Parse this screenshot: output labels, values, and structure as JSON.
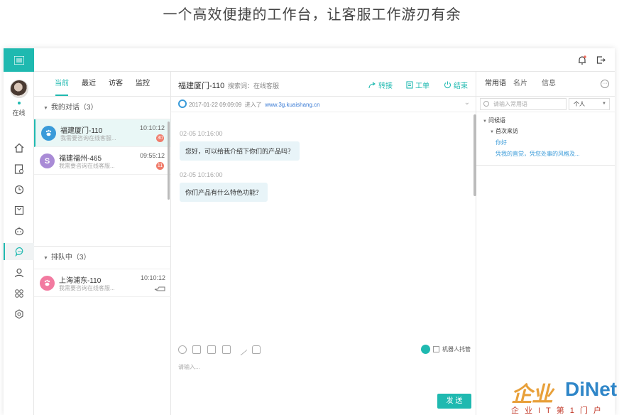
{
  "headline": "一个高效便捷的工作台，让客服工作游刃有余",
  "rail": {
    "status": "在线",
    "icons": [
      "home-icon",
      "report-icon",
      "history-icon",
      "order-icon",
      "robot-icon",
      "chat-icon",
      "contacts-icon",
      "apps-icon",
      "settings-icon"
    ]
  },
  "conversations": {
    "tabs": [
      "当前",
      "最近",
      "访客",
      "监控"
    ],
    "active_tab": "当前",
    "my_group": "我的对话（3）",
    "my_items": [
      {
        "name": "福建厦门-110",
        "preview": "我需要咨询在线客服...",
        "time": "10:10:12",
        "badge": "30",
        "avatar": "paw",
        "color": "#3a9bd9"
      },
      {
        "name": "福建福州-465",
        "preview": "我需要咨询在线客服...",
        "time": "09:55:12",
        "badge": "11",
        "avatar": "S",
        "color": "#a98bd6"
      }
    ],
    "queue_group": "排队中（3）",
    "queue_items": [
      {
        "name": "上海浦东-110",
        "preview": "我需要咨询在线客服...",
        "time": "10:10:12",
        "avatar": "paw",
        "color": "#f27aa0"
      }
    ]
  },
  "chat": {
    "title": "福建厦门-110",
    "keyword": "搜索词：在线客服",
    "actions": {
      "transfer": "转接",
      "ticket": "工单",
      "end": "结束"
    },
    "visit_time": "2017-01-22 09:09:09",
    "visit_enter": "进入了",
    "visit_site": "www.3g.kuaishang.cn",
    "messages": [
      {
        "time": "02-05 10:16:00",
        "text": "您好，可以给我介绍下你们的产品吗？"
      },
      {
        "time": "02-05 10:16:00",
        "text": "你们产品有什么特色功能？"
      }
    ],
    "robot_label": "机器人托管",
    "input_placeholder": "请输入...",
    "send": "发 送"
  },
  "right": {
    "tabs": [
      "常用语",
      "名片",
      "信息"
    ],
    "active_tab": "常用语",
    "search_placeholder": "请输入常用语",
    "scope": "个人",
    "tree": {
      "root": "问候语",
      "child": "首次来访",
      "items": [
        "你好",
        "凭我的直觉，凭您处事的风格及..."
      ]
    }
  },
  "watermark": {
    "big": "企业",
    "net": "DiNet",
    "sub": "企业IT第1门户"
  },
  "colors": {
    "accent": "#1fb9b0",
    "link": "#3a9bd9",
    "badge": "#f07b6a"
  }
}
